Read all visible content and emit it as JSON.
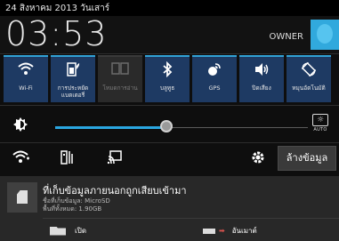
{
  "status_bar": {
    "date": "24 สิงหาคม 2013 วันเสาร์"
  },
  "header": {
    "clock": "03:53",
    "owner_label": "OWNER"
  },
  "quick_settings": [
    {
      "id": "wifi",
      "icon": "wifi-icon",
      "glyph": "📶",
      "label": "Wi-Fi",
      "enabled": true
    },
    {
      "id": "power",
      "icon": "power-saving-icon",
      "glyph": "▣",
      "label": "การประหยัดแบตเตอรี่",
      "enabled": true
    },
    {
      "id": "reading",
      "icon": "reading-mode-icon",
      "glyph": "▦",
      "label": "โหมดการอ่าน",
      "enabled": false
    },
    {
      "id": "bluetooth",
      "icon": "bluetooth-icon",
      "glyph": "✱",
      "label": "บลูทูธ",
      "enabled": true
    },
    {
      "id": "gps",
      "icon": "gps-icon",
      "glyph": "◉",
      "label": "GPS",
      "enabled": true
    },
    {
      "id": "sound",
      "icon": "sound-icon",
      "glyph": "🔊",
      "label": "ปิดเสียง",
      "enabled": true
    },
    {
      "id": "rotate",
      "icon": "auto-rotate-icon",
      "glyph": "⟲",
      "label": "หมุนอัตโนมัติ",
      "enabled": true
    }
  ],
  "brightness": {
    "level": 0.44,
    "auto_label": "AUTO",
    "auto_icon": "auto-brightness-icon"
  },
  "actions": {
    "wifi_settings_icon": "wifi-settings-icon",
    "task_manager_icon": "task-manager-icon",
    "screen_cast_icon": "screen-cast-icon",
    "settings_icon": "gear-icon",
    "clear_label": "ล้างข้อมูล"
  },
  "notification": {
    "title": "ที่เก็บข้อมูลภายนอกถูกเสียบเข้ามา",
    "line1": "ชื่อที่เก็บข้อมูล: MicroSD",
    "line2": "พื้นที่ทั้งหมด: 1.90GB",
    "open_label": "เปิด",
    "unmount_label": "อันเมาต์"
  }
}
